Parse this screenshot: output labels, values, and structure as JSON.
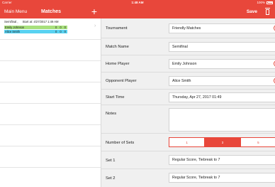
{
  "status_bar": {
    "carrier": "Carrier",
    "time": "1:48 AM",
    "battery": "100%"
  },
  "nav": {
    "menu_label": "Main Menu",
    "title": "Matches",
    "add_icon": "+",
    "save_label": "Save"
  },
  "matches": [
    {
      "title": "Semifinal ,",
      "start": "Start at: 4/27/2017 1:49 AM",
      "players": [
        {
          "name": "Emily Johnson",
          "scores": [
            "0",
            "0",
            "0"
          ]
        },
        {
          "name": "Alice Smith",
          "scores": [
            "0",
            "0",
            "0"
          ]
        }
      ]
    }
  ],
  "form": {
    "tournament": {
      "label": "Tournament",
      "value": "Friendly Matches"
    },
    "match_name": {
      "label": "Match Name",
      "value": "Semifinal"
    },
    "home_player": {
      "label": "Home Player",
      "value": "Emily Johnson"
    },
    "opponent_player": {
      "label": "Opponent Player",
      "value": "Alice Smith"
    },
    "start_time": {
      "label": "Start Time",
      "value": "Thursday, Apr 27, 2017 01:49"
    },
    "notes": {
      "label": "Notes",
      "value": ""
    },
    "number_of_sets": {
      "label": "Number of Sets",
      "options": [
        "1",
        "3",
        "5"
      ],
      "selected": "3"
    },
    "set1": {
      "label": "Set 1",
      "value": "Regular Score, Tiebreak to 7"
    },
    "set2": {
      "label": "Set 2",
      "value": "Regular Score, Tiebreak to 7"
    }
  },
  "colors": {
    "accent": "#e8473b",
    "home_bar": "#a7e07c",
    "away_bar": "#58d2f1"
  }
}
